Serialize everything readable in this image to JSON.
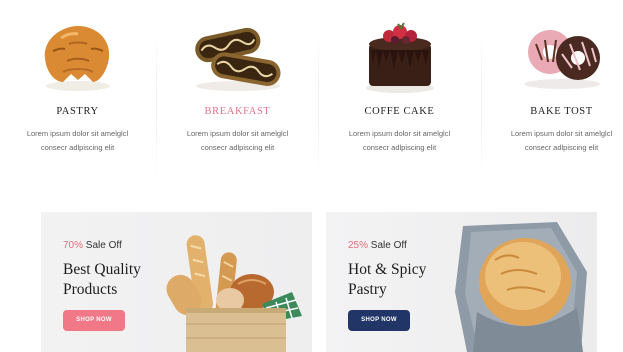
{
  "categories": [
    {
      "title": "PASTRY",
      "desc_line1": "Lorem ipsum dolor sit amelglcl",
      "desc_line2": "consecr adlpiscing elit",
      "icon": "croissant-icon"
    },
    {
      "title": "BREAKFAST",
      "desc_line1": "Lorem ipsum dolor sit amelglcl",
      "desc_line2": "consecr adlpiscing elit",
      "icon": "rolls-icon"
    },
    {
      "title": "COFFE CAKE",
      "desc_line1": "Lorem ipsum dolor sit amelglcl",
      "desc_line2": "consecr adlpiscing elit",
      "icon": "chocolate-cake-icon"
    },
    {
      "title": "BAKE TOST",
      "desc_line1": "Lorem ipsum dolor sit amelglcl",
      "desc_line2": "consecr adlpiscing elit",
      "icon": "donut-icon"
    }
  ],
  "banners": [
    {
      "percent": "70%",
      "sale_label": "Sale Off",
      "headline_line1": "Best Quality",
      "headline_line2": "Products",
      "button_label": "SHOP NOW",
      "button_color": "#f07887",
      "image": "bread-basket"
    },
    {
      "percent": "25%",
      "sale_label": "Sale Off",
      "headline_line1": "Hot & Spicy",
      "headline_line2": "Pastry",
      "button_label": "SHOP NOW",
      "button_color": "#213666",
      "image": "round-loaf-in-cloth"
    }
  ],
  "colors": {
    "accent_pink": "#e36d79",
    "navy": "#213666",
    "title_pink": "#e0748d"
  }
}
